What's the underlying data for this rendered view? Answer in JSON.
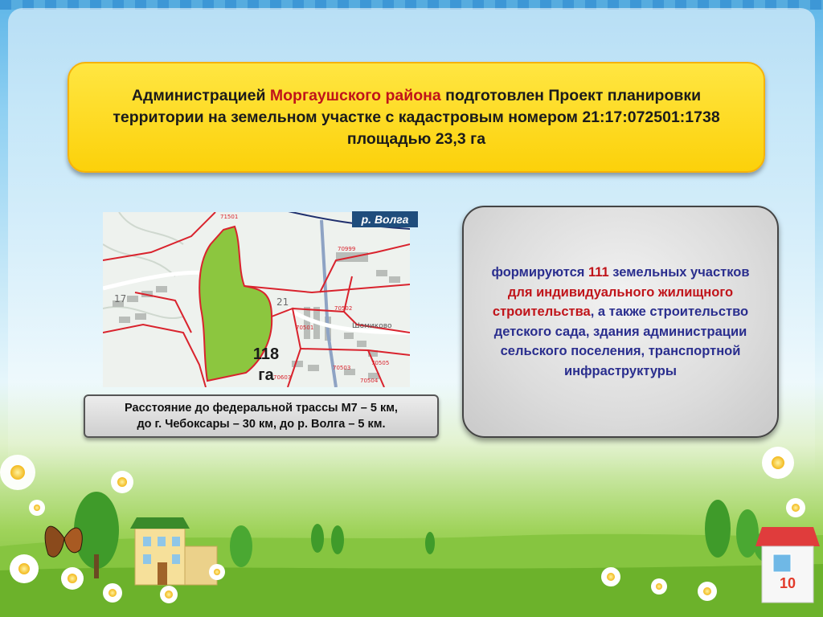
{
  "slide": {
    "title": {
      "part1": "Администрацией ",
      "highlight": "Моргаушского района",
      "part2": " подготовлен Проект планировки территории на земельном участке с кадастровым номером 21:17:072501:1738 площадью 23,3 га"
    },
    "map": {
      "river_label": "р. Волга",
      "area_number": "118",
      "area_unit": "га",
      "labels": {
        "l1": "71501",
        "l2": "70999",
        "l3": "17",
        "l4": "21",
        "l5": "70502",
        "l6": "70501",
        "l7": "Шомиково",
        "l8": "70503",
        "l9": "70505",
        "l10": "70504",
        "l11": "70603"
      }
    },
    "distance": {
      "line1": "Расстояние до федеральной трассы М7 – 5 км,",
      "line2": "до г. Чебоксары – 30 км, до р. Волга – 5 км."
    },
    "info": {
      "t1": "формируются ",
      "t2": "111",
      "t3": " земельных участков ",
      "t4": "для индивидуального жилищного строительства",
      "t5": ", а также строительство детского сада, здания администрации сельского поселения, транспортной инфраструктуры"
    },
    "page_number": "10"
  },
  "colors": {
    "title_bg": "#fcd10a",
    "highlight_red": "#c0141a",
    "info_text": "#2a2e8e",
    "green_area": "#8cc63f",
    "map_boundary": "#d9232d"
  }
}
